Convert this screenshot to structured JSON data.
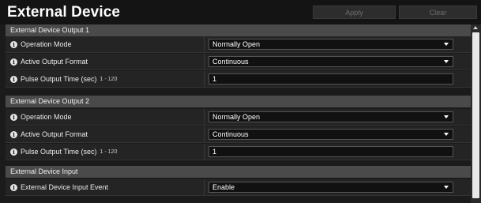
{
  "header": {
    "title": "External Device",
    "apply_label": "Apply",
    "clear_label": "Clear"
  },
  "sections": [
    {
      "title": "External Device Output 1",
      "rows": [
        {
          "label": "Operation Mode",
          "value": "Normally Open"
        },
        {
          "label": "Active Output Format",
          "value": "Continuous"
        },
        {
          "label": "Pulse Output Time (sec)",
          "range": "1 - 120",
          "value": "1"
        }
      ]
    },
    {
      "title": "External Device Output 2",
      "rows": [
        {
          "label": "Operation Mode",
          "value": "Normally Open"
        },
        {
          "label": "Active Output Format",
          "value": "Continuous"
        },
        {
          "label": "Pulse Output Time (sec)",
          "range": "1 - 120",
          "value": "1"
        }
      ]
    },
    {
      "title": "External Device Input",
      "rows": [
        {
          "label": "External Device Input Event",
          "value": "Enable"
        }
      ]
    }
  ],
  "icons": {
    "info": "info-icon",
    "dropdown": "chevron-down-icon",
    "scroll_up": "scroll-up-arrow-icon"
  },
  "colors": {
    "background": "#1b1b1b",
    "section_header": "#4a4a4a",
    "field_background": "#111111"
  }
}
